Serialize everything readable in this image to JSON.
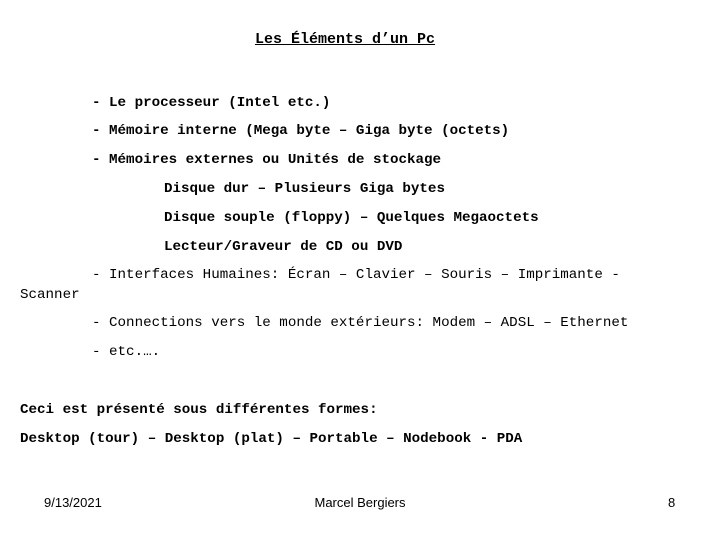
{
  "slide": {
    "title": "Les Éléments d’un Pc",
    "items": [
      "- Le processeur (Intel etc.)",
      "- Mémoire interne (Mega byte – Giga byte (octets)",
      "- Mémoires externes ou Unités de stockage"
    ],
    "subitems": [
      "Disque dur – Plusieurs Giga bytes",
      "Disque souple (floppy) – Quelques Megaoctets",
      "Lecteur/Graveur de CD ou DVD"
    ],
    "interfaces_line1": "- Interfaces Humaines: Écran – Clavier – Souris – Imprimante -",
    "interfaces_line2": "Scanner",
    "connections": "- Connections vers le monde extérieurs: Modem – ADSL – Ethernet",
    "etc": "- etc.….",
    "forms_intro": "Ceci est présenté sous différentes formes:",
    "forms_list": "Desktop (tour) – Desktop (plat) – Portable – Nodebook - PDA"
  },
  "footer": {
    "date": "9/13/2021",
    "author": "Marcel Bergiers",
    "page": "8"
  }
}
